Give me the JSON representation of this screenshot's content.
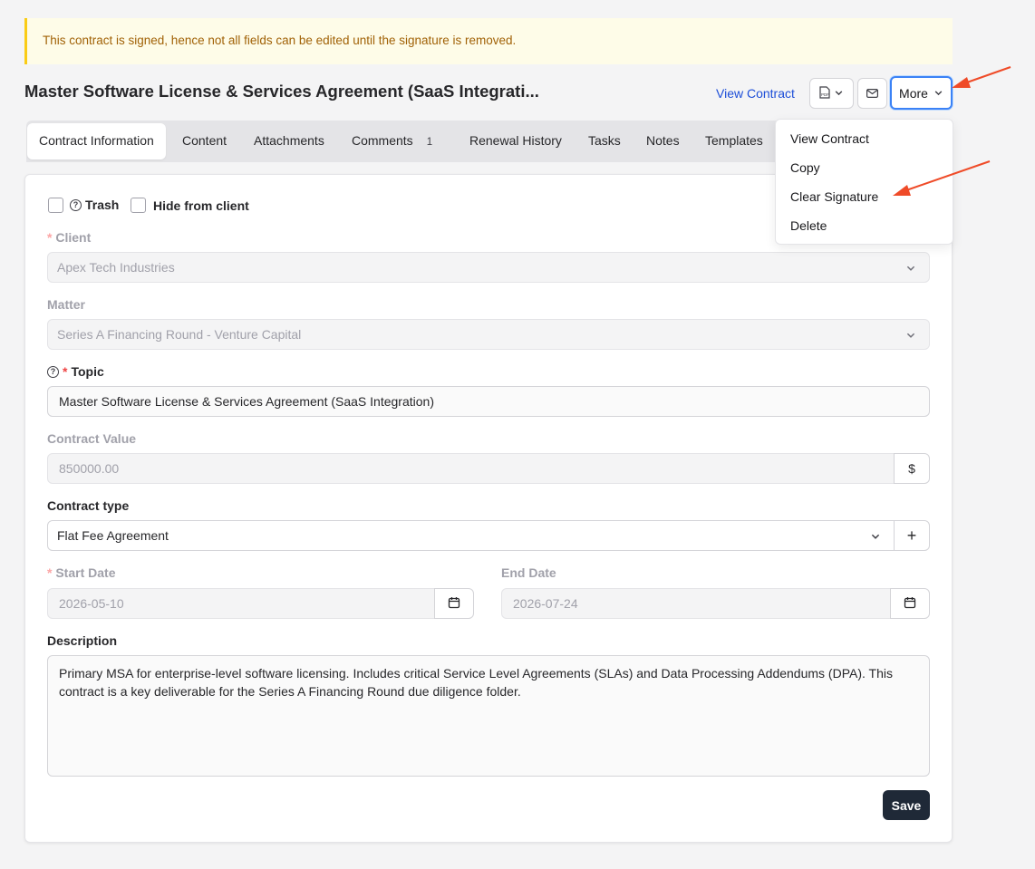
{
  "alert": {
    "text": "This contract is signed, hence not all fields can be edited until the signature is removed."
  },
  "header": {
    "title": "Master Software License & Services Agreement (SaaS Integrati...",
    "view_contract_label": "View Contract",
    "more_label": "More"
  },
  "tabs": [
    {
      "label": "Contract Information"
    },
    {
      "label": "Content"
    },
    {
      "label": "Attachments"
    },
    {
      "label": "Comments",
      "count": "1"
    },
    {
      "label": "Renewal History"
    },
    {
      "label": "Tasks"
    },
    {
      "label": "Notes"
    },
    {
      "label": "Templates"
    }
  ],
  "form": {
    "trash_label": "Trash",
    "hide_label": "Hide from client",
    "client": {
      "label": "Client",
      "value": "Apex Tech Industries"
    },
    "matter": {
      "label": "Matter",
      "value": "Series A Financing Round - Venture Capital"
    },
    "topic": {
      "label": "Topic",
      "value": "Master Software License & Services Agreement (SaaS Integration)"
    },
    "contract_value": {
      "label": "Contract Value",
      "value": "850000.00",
      "currency": "$"
    },
    "contract_type": {
      "label": "Contract type",
      "value": "Flat Fee Agreement",
      "add": "+"
    },
    "start_date": {
      "label": "Start Date",
      "value": "2026-05-10"
    },
    "end_date": {
      "label": "End Date",
      "value": "2026-07-24"
    },
    "description": {
      "label": "Description",
      "value": "Primary MSA for enterprise-level software licensing. Includes critical Service Level Agreements (SLAs) and Data Processing Addendums (DPA). This contract is a key deliverable for the Series A Financing Round due diligence folder."
    },
    "save_label": "Save",
    "required_mark": "*"
  },
  "more_menu": {
    "items": [
      {
        "label": "View Contract"
      },
      {
        "label": "Copy"
      },
      {
        "label": "Clear Signature"
      },
      {
        "label": "Delete"
      }
    ]
  },
  "colors": {
    "accent": "#1d4ed8",
    "focus": "#3b82f6",
    "alert_bg": "#fefce8",
    "alert_text": "#a16207",
    "annotation": "#ef4b28",
    "save_bg": "#1f2937"
  },
  "icons": [
    "pdf-icon",
    "chevron-down-icon",
    "mail-icon",
    "help-circle-icon",
    "calendar-icon",
    "plus-icon",
    "arrow-annotation"
  ]
}
